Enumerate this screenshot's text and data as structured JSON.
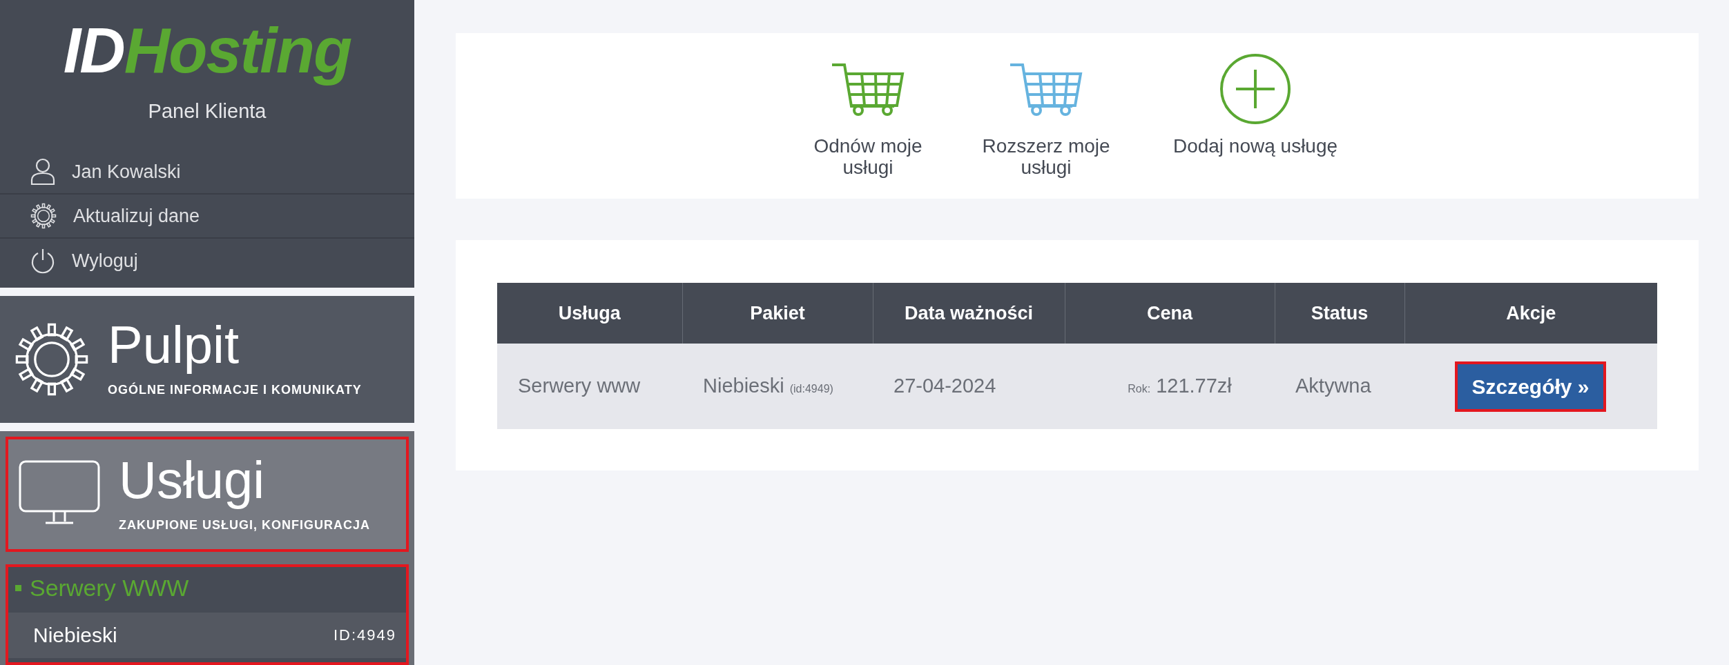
{
  "logo": {
    "prefix": "ID",
    "name": "Hosting"
  },
  "panel_title": "Panel Klienta",
  "user_menu": [
    {
      "kind": "user",
      "label": "Jan Kowalski"
    },
    {
      "kind": "settings",
      "label": "Aktualizuj dane"
    },
    {
      "kind": "logout",
      "label": "Wyloguj"
    }
  ],
  "sections": [
    {
      "kind": "dashboard",
      "title": "Pulpit",
      "subtitle": "OGÓLNE INFORMACJE I KOMUNIKATY",
      "selected": false,
      "highlighted": false
    },
    {
      "kind": "services",
      "title": "Usługi",
      "subtitle": "ZAKUPIONE USŁUGI, KONFIGURACJA",
      "selected": true,
      "highlighted": true
    }
  ],
  "submenu": {
    "title": "Serwery WWW",
    "highlighted": true,
    "items": [
      {
        "label": "Niebieski",
        "id": "ID:4949"
      }
    ]
  },
  "quick_actions": [
    {
      "kind": "renew",
      "label": "Odnów moje usługi"
    },
    {
      "kind": "extend",
      "label": "Rozszerz moje usługi"
    },
    {
      "kind": "add",
      "label": "Dodaj nową usługę"
    }
  ],
  "table": {
    "columns": [
      "Usługa",
      "Pakiet",
      "Data ważności",
      "Cena",
      "Status",
      "Akcje"
    ],
    "rows": [
      {
        "service": "Serwery www",
        "package": "Niebieski",
        "package_id": "(id:4949)",
        "expiry": "27-04-2024",
        "price_period": "Rok:",
        "price": "121.77zł",
        "status": "Aktywna",
        "action": "Szczegóły »",
        "action_highlighted": true
      }
    ]
  }
}
